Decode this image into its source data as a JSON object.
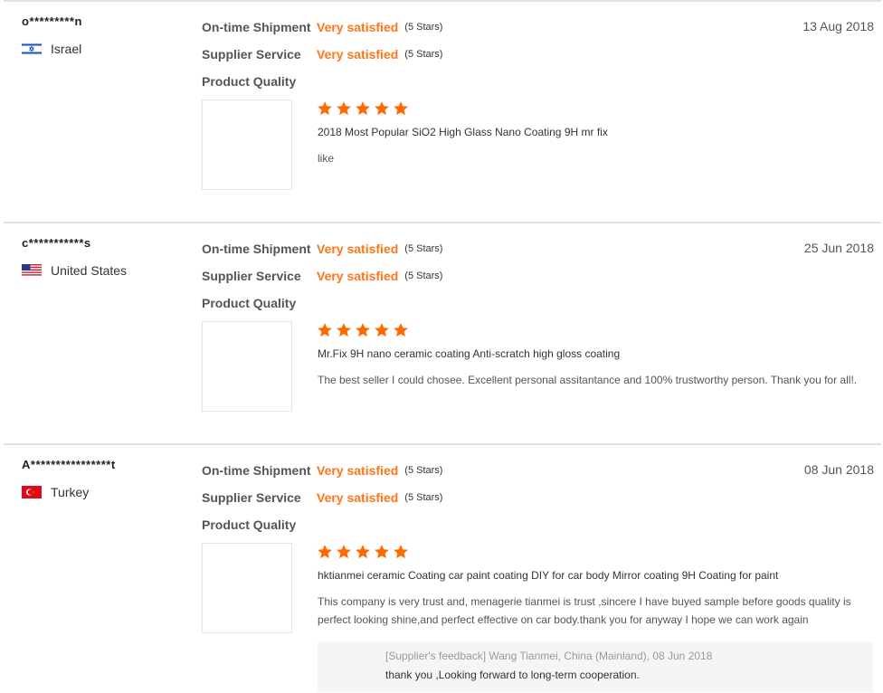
{
  "colors": {
    "accent": "#ff7519",
    "star": "#ff6a00",
    "divider": "#e1e1e1"
  },
  "reviews": [
    {
      "buyer": "o*********n",
      "country": "Israel",
      "flag_icon": "israel-flag-icon",
      "date": "13 Aug 2018",
      "ratings": [
        {
          "label": "On-time Shipment",
          "value": "Very satisfied",
          "stars": "(5 Stars)"
        },
        {
          "label": "Supplier Service",
          "value": "Very satisfied",
          "stars": "(5 Stars)"
        },
        {
          "label": "Product Quality"
        }
      ],
      "product_rating": 5,
      "product_title": "2018 Most Popular SiO2 High Glass Nano Coating 9H mr fix",
      "comment": "like"
    },
    {
      "buyer": "c***********s",
      "country": "United States",
      "flag_icon": "us-flag-icon",
      "date": "25 Jun 2018",
      "ratings": [
        {
          "label": "On-time Shipment",
          "value": "Very satisfied",
          "stars": "(5 Stars)"
        },
        {
          "label": "Supplier Service",
          "value": "Very satisfied",
          "stars": "(5 Stars)"
        },
        {
          "label": "Product Quality"
        }
      ],
      "product_rating": 5,
      "product_title": "Mr.Fix 9H nano ceramic coating Anti-scratch high gloss coating",
      "comment": "The best seller I could chosee. Excellent personal assitantance and 100% trustworthy person. Thank you for all!."
    },
    {
      "buyer": "A****************t",
      "country": "Turkey",
      "flag_icon": "turkey-flag-icon",
      "date": "08 Jun 2018",
      "ratings": [
        {
          "label": "On-time Shipment",
          "value": "Very satisfied",
          "stars": "(5 Stars)"
        },
        {
          "label": "Supplier Service",
          "value": "Very satisfied",
          "stars": "(5 Stars)"
        },
        {
          "label": "Product Quality"
        }
      ],
      "product_rating": 5,
      "product_title": "hktianmei ceramic Coating car paint coating DIY for car body Mirror coating 9H Coating for paint",
      "comment": "This company is very trust and, menagerie tianmei is trust ,sincere I have buyed sample before goods quality is perfect looking shine,and perfect effective on car body.thank you for anyway I hope we can work again",
      "supplier_feedback": {
        "meta": "[Supplier's feedback] Wang Tianmei, China (Mainland), 08 Jun 2018",
        "text": "thank you ,Looking forward to long-term cooperation."
      }
    }
  ]
}
